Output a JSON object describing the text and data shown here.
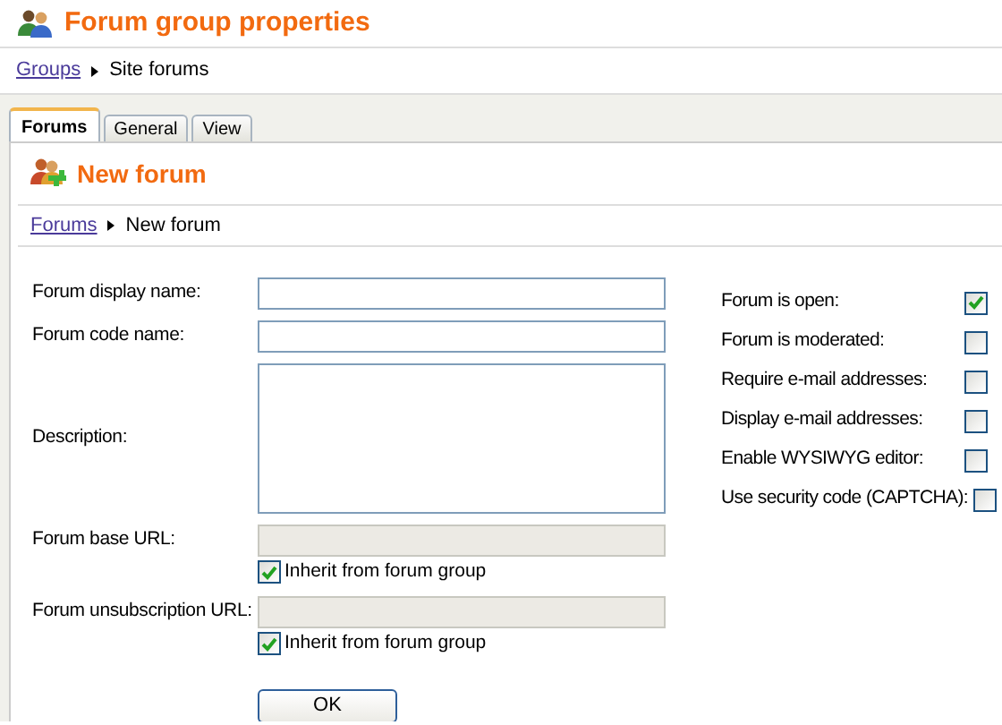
{
  "header": {
    "title": "Forum group properties"
  },
  "breadcrumb": {
    "link": "Groups",
    "current": "Site forums"
  },
  "tabs": [
    {
      "label": "Forums",
      "selected": true
    },
    {
      "label": "General",
      "selected": false
    },
    {
      "label": "View",
      "selected": false
    }
  ],
  "section": {
    "title": "New forum",
    "breadcrumb": {
      "link": "Forums",
      "current": "New forum"
    }
  },
  "fields": [
    {
      "label": "Forum display name:",
      "kind": "text",
      "disabled": false
    },
    {
      "label": "Forum code name:",
      "kind": "text",
      "disabled": false
    },
    {
      "label": "Description:",
      "kind": "textarea",
      "disabled": false
    },
    {
      "label": "Forum base URL:",
      "kind": "text",
      "disabled": true,
      "inherit": {
        "label": "Inherit from forum group",
        "checked": true
      }
    },
    {
      "label": "Forum unsubscription URL:",
      "kind": "text",
      "disabled": true,
      "inherit": {
        "label": "Inherit from forum group",
        "checked": true
      }
    }
  ],
  "options": [
    {
      "label": "Forum is open:",
      "checked": true
    },
    {
      "label": "Forum is moderated:",
      "checked": false
    },
    {
      "label": "Require e-mail addresses:",
      "checked": false
    },
    {
      "label": "Display e-mail addresses:",
      "checked": false
    },
    {
      "label": "Enable WYSIWYG editor:",
      "checked": false
    },
    {
      "label": "Use security code (CAPTCHA):",
      "checked": false
    }
  ],
  "submit": "OK"
}
